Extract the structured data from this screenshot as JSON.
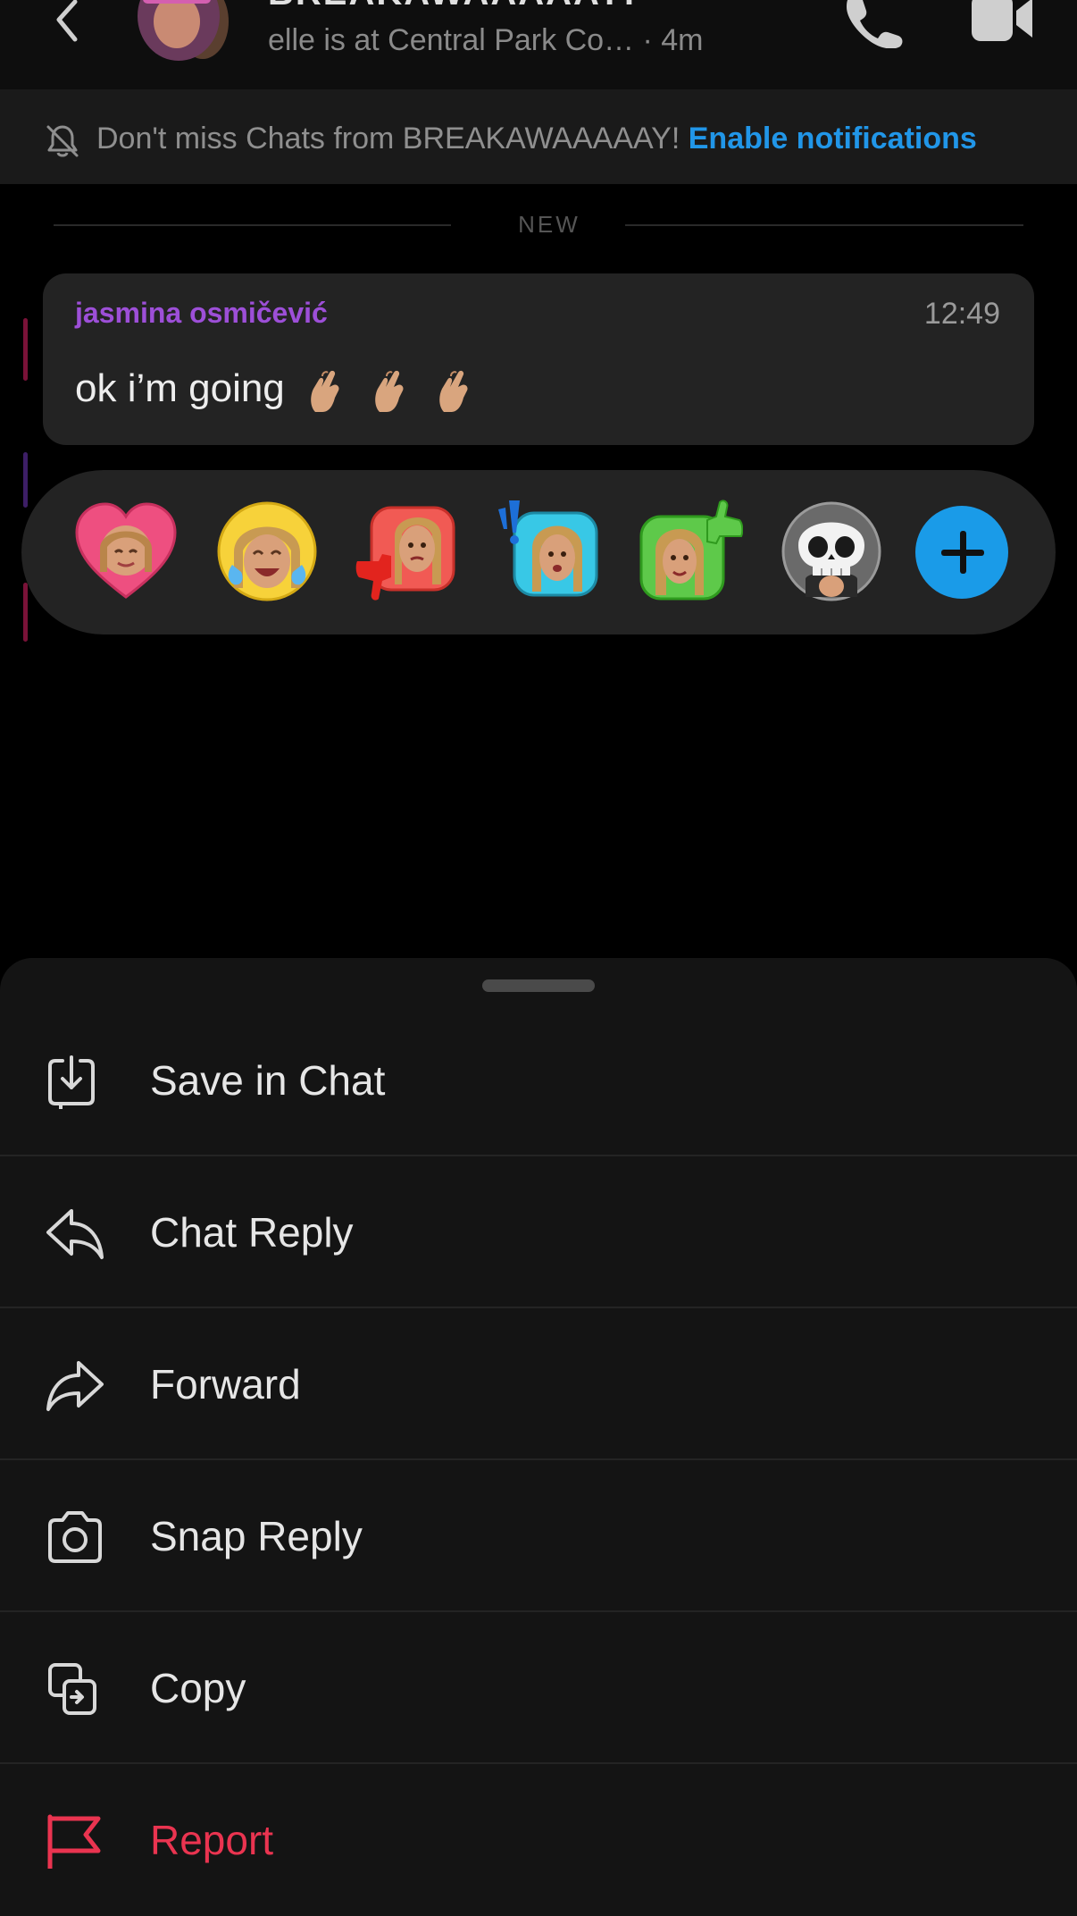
{
  "header": {
    "title": "BREAKAWAAAAAY!",
    "subtitle": "elle is at Central Park Co… · 4m"
  },
  "banner": {
    "text": "Don't miss Chats from BREAKAWAAAAAY!",
    "link": "Enable notifications"
  },
  "divider": {
    "label": "NEW"
  },
  "message": {
    "sender": "jasmina osmičević",
    "time": "12:49",
    "text": "ok i’m going",
    "emoji": [
      "hand-heart-emoji",
      "hand-heart-emoji",
      "hand-heart-emoji"
    ]
  },
  "reactions": {
    "items": [
      "heart-bitmoji",
      "laugh-cry-bitmoji",
      "thumbs-down-bitmoji",
      "exclaim-bitmoji",
      "thumbs-up-bitmoji",
      "skull-bitmoji"
    ],
    "add": "add-reaction"
  },
  "menu": {
    "items": [
      {
        "label": "Save in Chat",
        "icon": "save-icon"
      },
      {
        "label": "Chat Reply",
        "icon": "reply-icon"
      },
      {
        "label": "Forward",
        "icon": "forward-icon"
      },
      {
        "label": "Snap Reply",
        "icon": "camera-icon"
      },
      {
        "label": "Copy",
        "icon": "copy-icon"
      },
      {
        "label": "Report",
        "icon": "flag-icon"
      }
    ]
  },
  "colors": {
    "accent_link": "#2196e8",
    "sender": "#9d4fd8",
    "danger": "#ea3450",
    "add_button": "#1a9be8"
  }
}
